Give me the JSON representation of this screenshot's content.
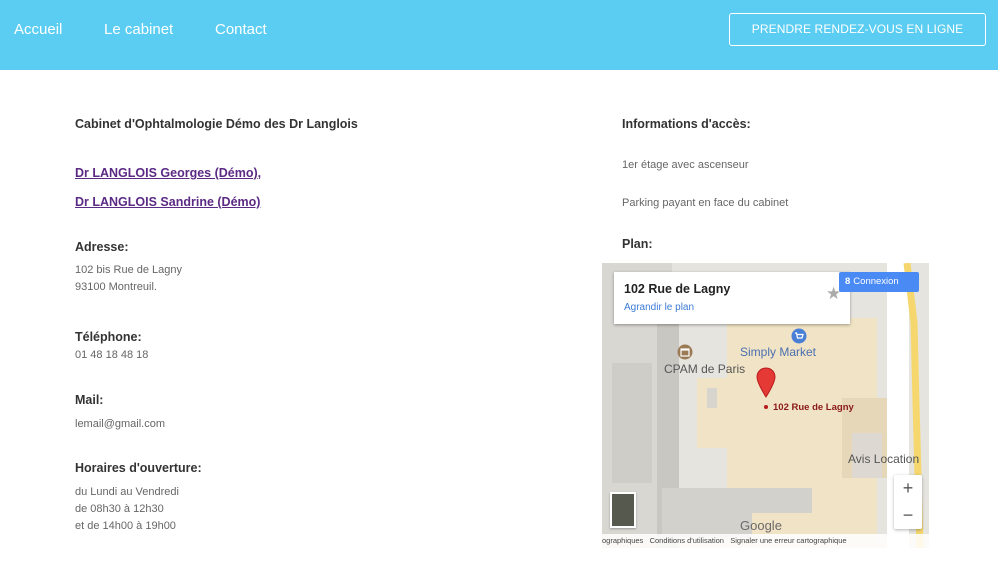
{
  "nav": {
    "home": "Accueil",
    "cabinet": "Le cabinet",
    "contact": "Contact",
    "cta": "PRENDRE RENDEZ-VOUS EN LIGNE"
  },
  "left": {
    "cabinet_name": "Cabinet d'Ophtalmologie Démo des Dr Langlois",
    "doctor1": "Dr LANGLOIS Georges (Démo)",
    "doctor1_sep": ",",
    "doctor2": "Dr LANGLOIS Sandrine (Démo)",
    "address_heading": "Adresse:",
    "address_line1": "102 bis Rue de Lagny",
    "address_line2": "93100 Montreuil.",
    "phone_heading": "Téléphone:",
    "phone": "01 48 18 48 18",
    "mail_heading": "Mail:",
    "mail": "lemail@gmail.com",
    "hours_heading": "Horaires d'ouverture:",
    "hours_line1": "du Lundi au Vendredi",
    "hours_line2": "de 08h30 à 12h30",
    "hours_line3": "et de 14h00 à 19h00"
  },
  "right": {
    "access_heading": "Informations d'accès:",
    "access_line1": "1er étage avec ascenseur",
    "access_line2": "Parking payant en face du cabinet",
    "plan_heading": "Plan:"
  },
  "map": {
    "card_title": "102 Rue de Lagny",
    "card_link": "Agrandir le plan",
    "signin": "Connexion",
    "signin_g": "8",
    "place_simply": "Simply Market",
    "place_cpam": "CPAM de Paris",
    "place_pin": "102 Rue de Lagny",
    "place_avis": "Avis Location",
    "logo": "Google",
    "footer_data": "ographiques",
    "footer_terms": "Conditions d'utilisation",
    "footer_report": "Signaler une erreur cartographique",
    "zoom_in": "+",
    "zoom_out": "−",
    "star": "★"
  },
  "colors": {
    "navbar": "#5bcdf2",
    "link": "#5b2a84",
    "pin": "#e53935"
  }
}
